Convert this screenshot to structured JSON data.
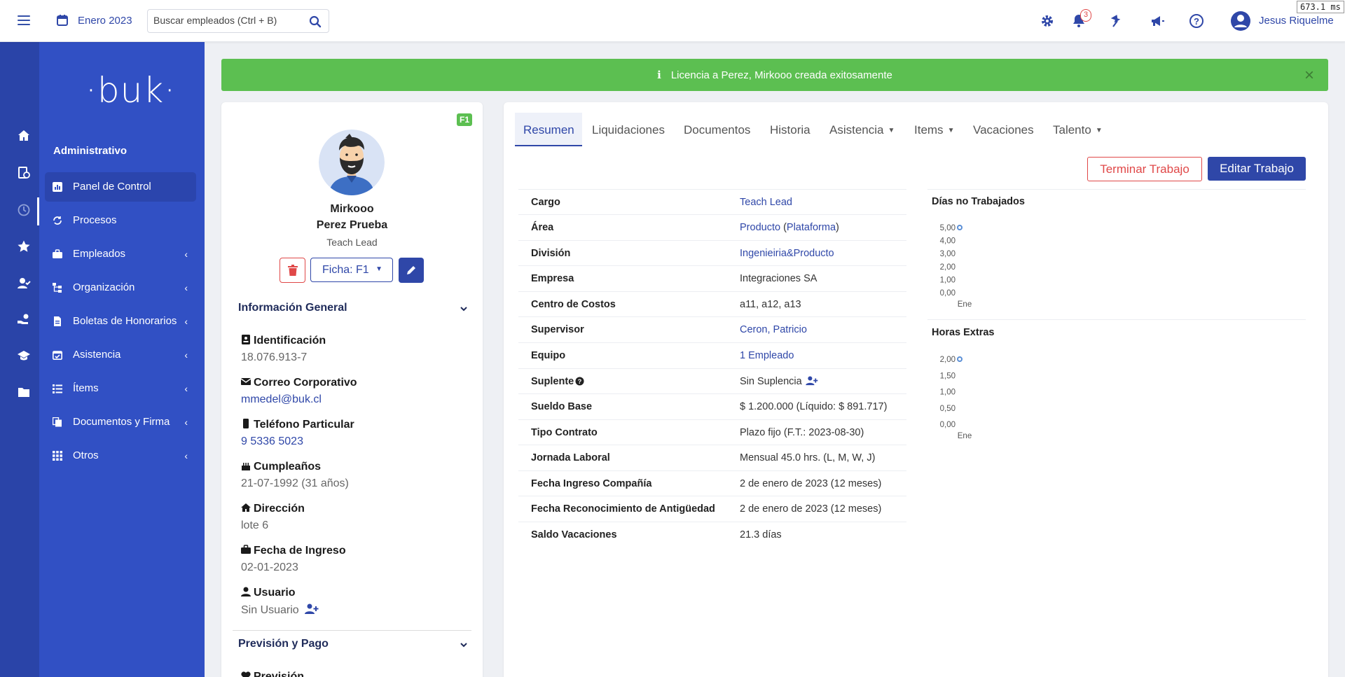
{
  "topbar": {
    "period": "Enero 2023",
    "search_placeholder": "Buscar empleados (Ctrl + B)",
    "notifications_count": "3",
    "user_name": "Jesus Riquelme",
    "perf_readout": "673.1 ms"
  },
  "sidebar": {
    "logo": "·buk·",
    "section": "Administrativo",
    "items": [
      {
        "label": "Panel de Control",
        "icon": "dashboard-icon",
        "active": true
      },
      {
        "label": "Procesos",
        "icon": "refresh-icon"
      },
      {
        "label": "Empleados",
        "icon": "briefcase-icon",
        "chevron": "‹"
      },
      {
        "label": "Organización",
        "icon": "org-chart-icon",
        "chevron": "‹"
      },
      {
        "label": "Boletas de Honorarios",
        "icon": "invoice-icon",
        "chevron": "‹"
      },
      {
        "label": "Asistencia",
        "icon": "calendar-check-icon",
        "chevron": "‹"
      },
      {
        "label": "Ítems",
        "icon": "list-icon",
        "chevron": "‹"
      },
      {
        "label": "Documentos y Firma",
        "icon": "documents-icon",
        "chevron": "‹"
      },
      {
        "label": "Otros",
        "icon": "grid-icon",
        "chevron": "‹"
      }
    ]
  },
  "alert": {
    "message": "Licencia a Perez, Mirkooo creada exitosamente",
    "close": "×"
  },
  "profile": {
    "badge": "F1",
    "first_name": "Mirkooo",
    "last_name": "Perez Prueba",
    "role": "Teach Lead",
    "ficha_label": "Ficha: F1",
    "general_title": "Información General",
    "fields": {
      "id_label": "Identificación",
      "id_value": "18.076.913-7",
      "email_label": "Correo Corporativo",
      "email_value": "mmedel@buk.cl",
      "phone_label": "Teléfono Particular",
      "phone_value": "9 5336 5023",
      "birthday_label": "Cumpleaños",
      "birthday_value": "21-07-1992 (31 años)",
      "address_label": "Dirección",
      "address_value": "lote 6",
      "start_label": "Fecha de Ingreso",
      "start_value": "02-01-2023",
      "user_label": "Usuario",
      "user_value": "Sin Usuario"
    },
    "prevision_title": "Previsión y Pago",
    "prevision_label": "Previsión"
  },
  "tabs": {
    "items": [
      "Resumen",
      "Liquidaciones",
      "Documentos",
      "Historia",
      "Asistencia",
      "Items",
      "Vacaciones",
      "Talento"
    ]
  },
  "actions": {
    "terminate": "Terminar Trabajo",
    "edit": "Editar Trabajo"
  },
  "summary": {
    "cargo_k": "Cargo",
    "cargo_v": "Teach Lead",
    "area_k": "Área",
    "area_v1": "Producto",
    "area_v2": "Plataforma",
    "division_k": "División",
    "division_v": "Ingenieiria&Producto",
    "empresa_k": "Empresa",
    "empresa_v": "Integraciones SA",
    "cc_k": "Centro de Costos",
    "cc_v": "a11, a12, a13",
    "sup_k": "Supervisor",
    "sup_v": "Ceron, Patricio",
    "equipo_k": "Equipo",
    "equipo_v": "1 Empleado",
    "suplente_k": "Suplente",
    "suplente_v": "Sin Suplencia",
    "sueldo_k": "Sueldo Base",
    "sueldo_v": "$ 1.200.000 (Líquido: $ 891.717)",
    "contrato_k": "Tipo Contrato",
    "contrato_v": "Plazo fijo (F.T.: 2023-08-30)",
    "jornada_k": "Jornada Laboral",
    "jornada_v": "Mensual 45.0 hrs. (L, M, W, J)",
    "fic_k": "Fecha Ingreso Compañía",
    "fic_v": "2 de enero de 2023 (12 meses)",
    "fra_k": "Fecha Reconocimiento de Antigüedad",
    "fra_v": "2 de enero de 2023 (12 meses)",
    "vac_k": "Saldo Vacaciones",
    "vac_v": "21.3 días"
  },
  "chart_data": [
    {
      "type": "scatter",
      "title": "Días no Trabajados",
      "categories": [
        "Ene"
      ],
      "values": [
        5.0
      ],
      "ylim": [
        0,
        5
      ],
      "yticks": [
        "5,00",
        "4,00",
        "3,00",
        "2,00",
        "1,00",
        "0,00"
      ],
      "color": "#5b8fd6",
      "grid": false
    },
    {
      "type": "scatter",
      "title": "Horas Extras",
      "categories": [
        "Ene"
      ],
      "values": [
        2.0
      ],
      "ylim": [
        0,
        2
      ],
      "yticks": [
        "2,00",
        "1,50",
        "1,00",
        "0,50",
        "0,00"
      ],
      "color": "#5b8fd6",
      "grid": false
    }
  ]
}
